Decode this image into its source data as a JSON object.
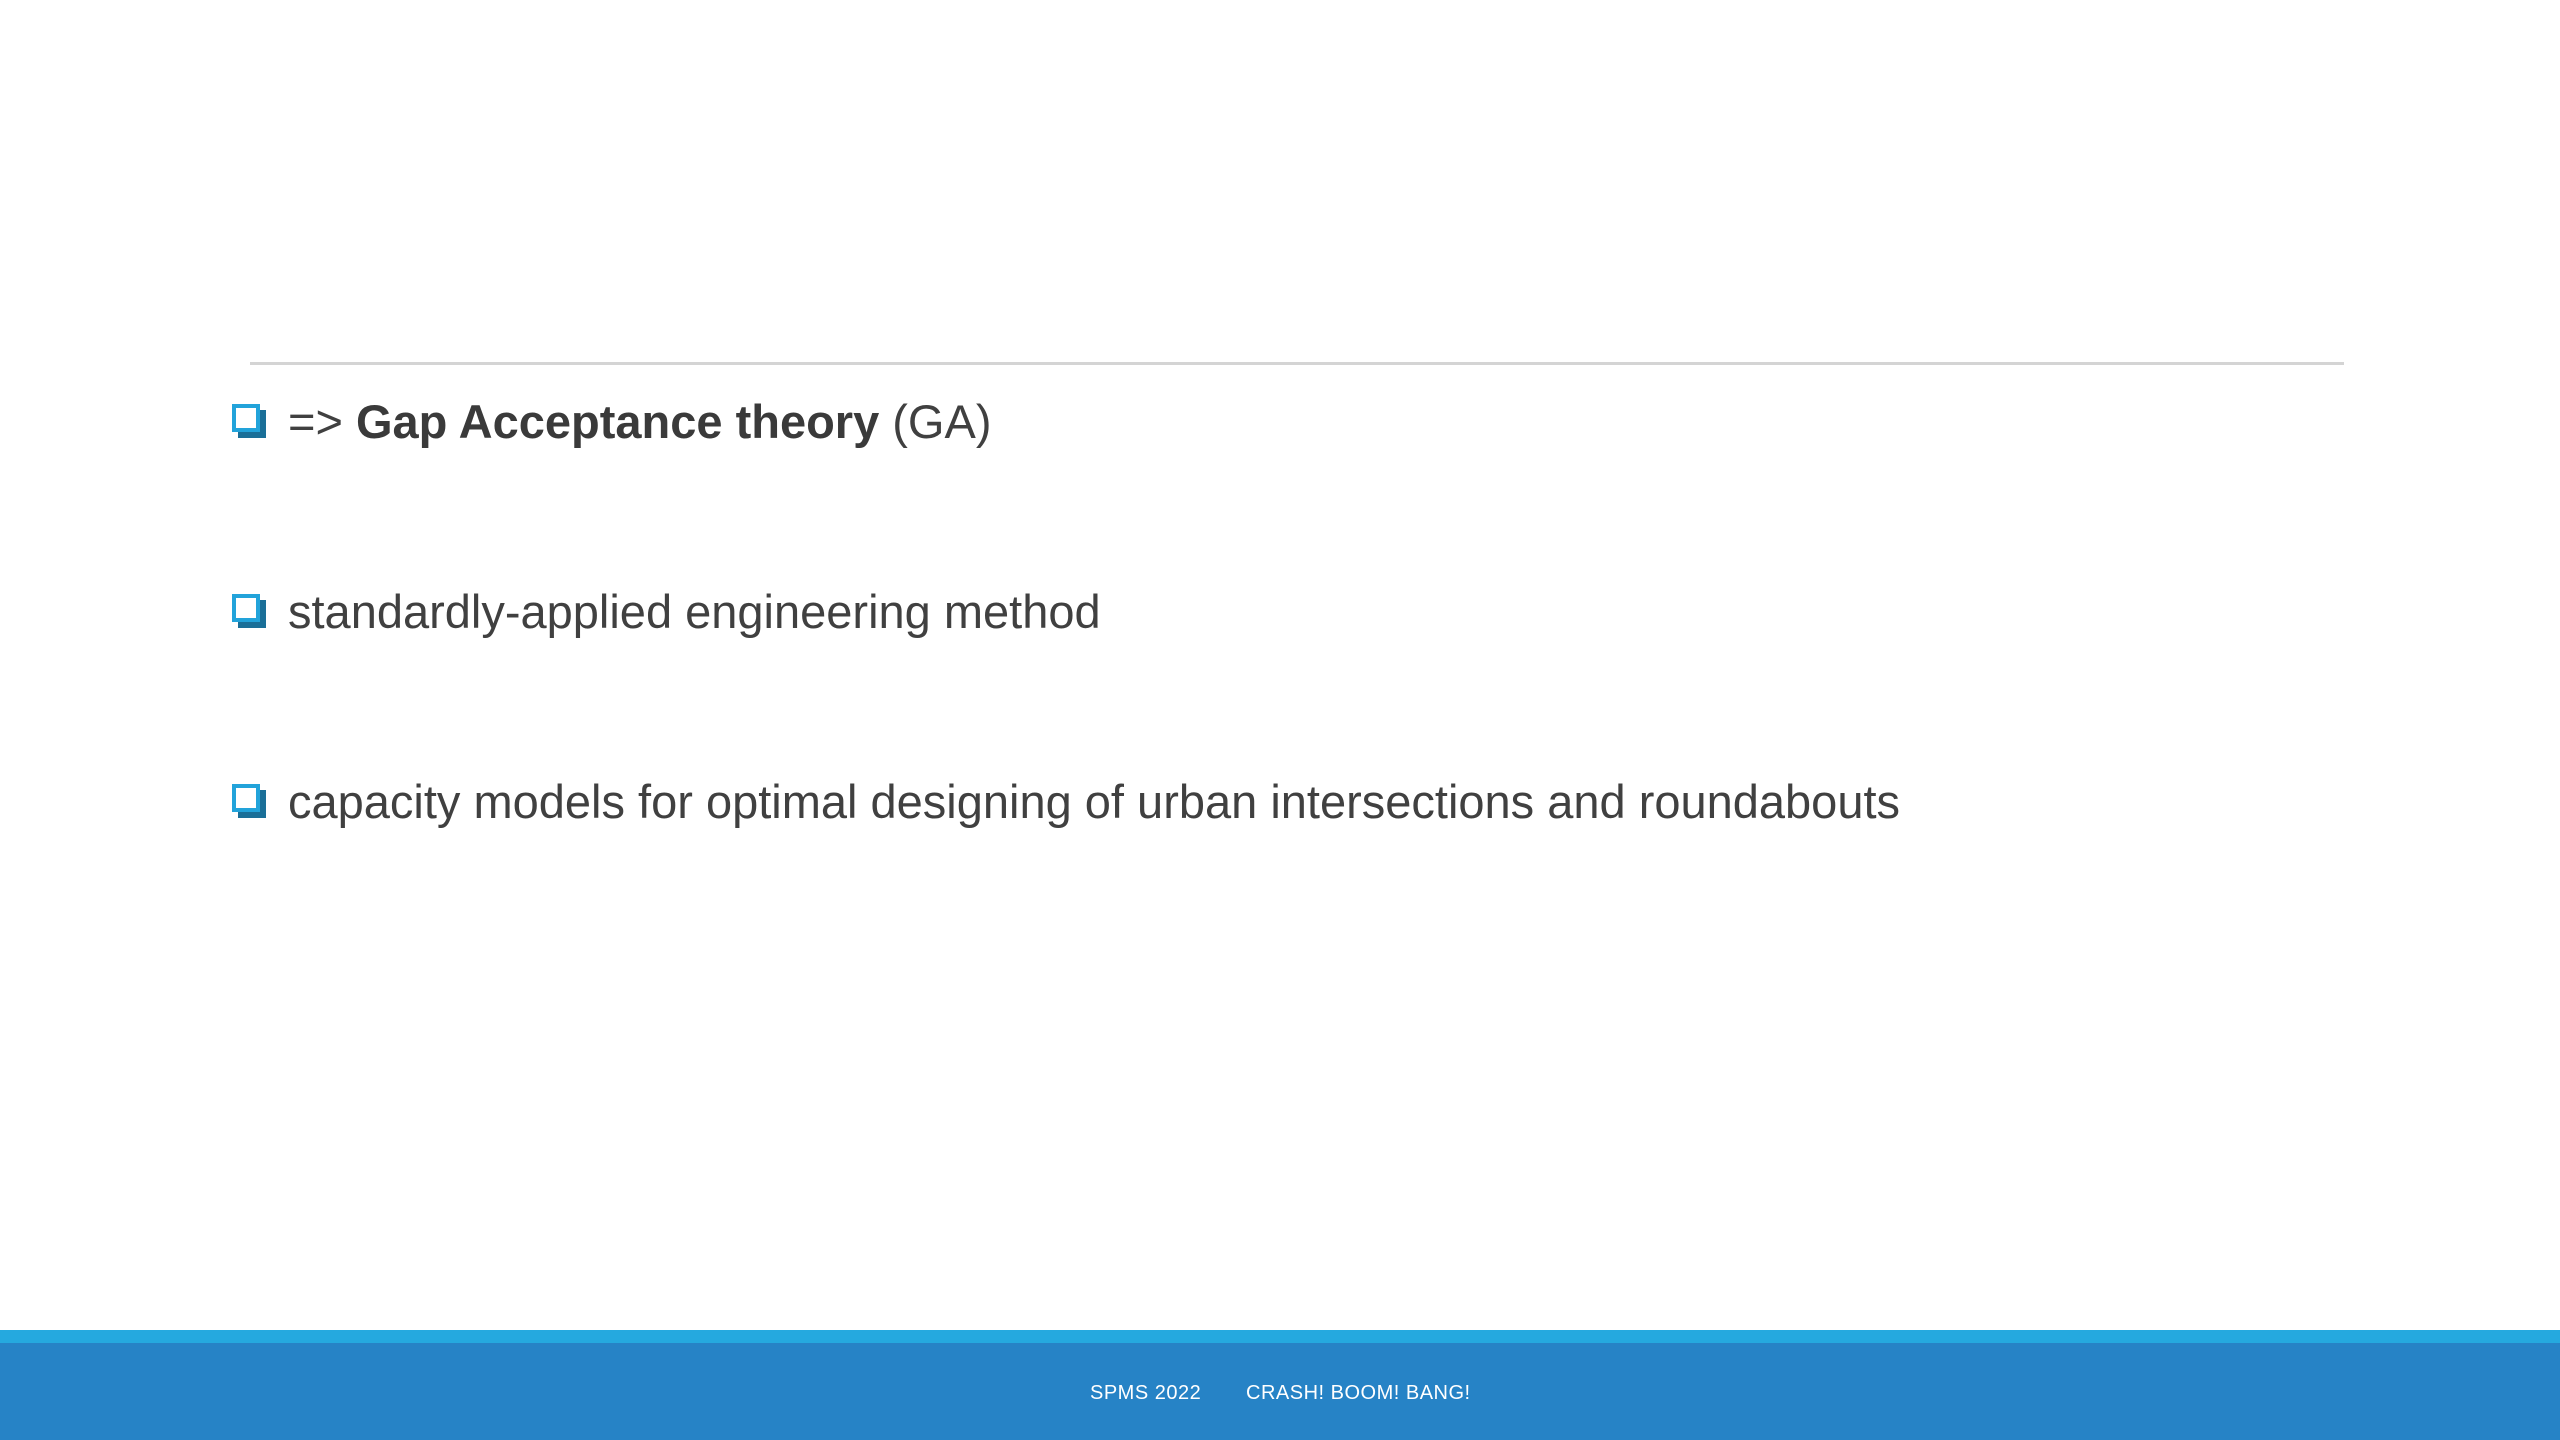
{
  "slide": {
    "bullets": [
      {
        "prefix": "=> ",
        "bold": "Gap Acceptance theory",
        "suffix": " (GA)"
      },
      {
        "text": "standardly-applied engineering method"
      },
      {
        "text": "capacity models for optimal designing of urban intersections and roundabouts"
      }
    ],
    "bullet_icon": "checkbox-square-icon"
  },
  "footer": {
    "left": "SPMS 2022",
    "right": "CRASH! BOOM! BANG!"
  },
  "colors": {
    "accent_stripe": "#25a9df",
    "footer_bg": "#2683c6",
    "bullet_icon": "#22a3da",
    "text": "#404040"
  }
}
